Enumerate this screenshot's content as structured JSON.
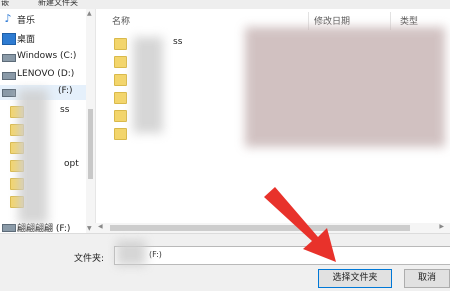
{
  "toolbar": {
    "left_label": "嵌",
    "new_folder": "新建文件夹"
  },
  "nav": {
    "items": [
      {
        "label": "音乐",
        "icon": "music-icon",
        "indent": false,
        "selected": false
      },
      {
        "label": "桌面",
        "icon": "desktop-icon",
        "indent": false,
        "selected": false
      },
      {
        "label": "Windows (C:)",
        "icon": "drive-icon",
        "indent": false,
        "selected": false
      },
      {
        "label": "LENOVO (D:)",
        "icon": "drive-icon",
        "indent": false,
        "selected": false
      },
      {
        "label": "(F:)",
        "icon": "drive-icon",
        "indent": false,
        "selected": true
      },
      {
        "label": "ss",
        "icon": "folder-icon",
        "indent": true,
        "selected": false
      },
      {
        "label": "",
        "icon": "folder-icon",
        "indent": true,
        "selected": false
      },
      {
        "label": "",
        "icon": "folder-icon",
        "indent": true,
        "selected": false
      },
      {
        "label": "opt",
        "icon": "folder-icon",
        "indent": true,
        "selected": false
      },
      {
        "label": "",
        "icon": "folder-icon",
        "indent": true,
        "selected": false
      },
      {
        "label": "",
        "icon": "folder-icon",
        "indent": true,
        "selected": false
      },
      {
        "label": "",
        "icon": "folder-icon",
        "indent": true,
        "selected": false
      },
      {
        "label": "",
        "icon": "folder-icon",
        "indent": true,
        "selected": false
      },
      {
        "label": "",
        "icon": "folder-icon",
        "indent": true,
        "selected": false
      },
      {
        "label": "翩翩翩翩 (F:)",
        "icon": "drive-icon",
        "indent": false,
        "selected": false
      }
    ]
  },
  "list": {
    "columns": {
      "name": "名称",
      "modified": "修改日期",
      "type": "类型"
    },
    "rows": [
      {
        "label": "ss",
        "icon": "folder-icon"
      },
      {
        "label": "",
        "icon": "folder-icon"
      },
      {
        "label": "",
        "icon": "folder-icon"
      },
      {
        "label": "",
        "icon": "folder-icon"
      },
      {
        "label": "",
        "icon": "folder-icon"
      },
      {
        "label": "",
        "icon": "folder-icon"
      }
    ]
  },
  "footer": {
    "folder_label": "文件夹:",
    "folder_value": "(F:)",
    "select_button": "选择文件夹",
    "cancel_button": "取消"
  },
  "annotation": {
    "arrow_color": "#e8322b"
  }
}
